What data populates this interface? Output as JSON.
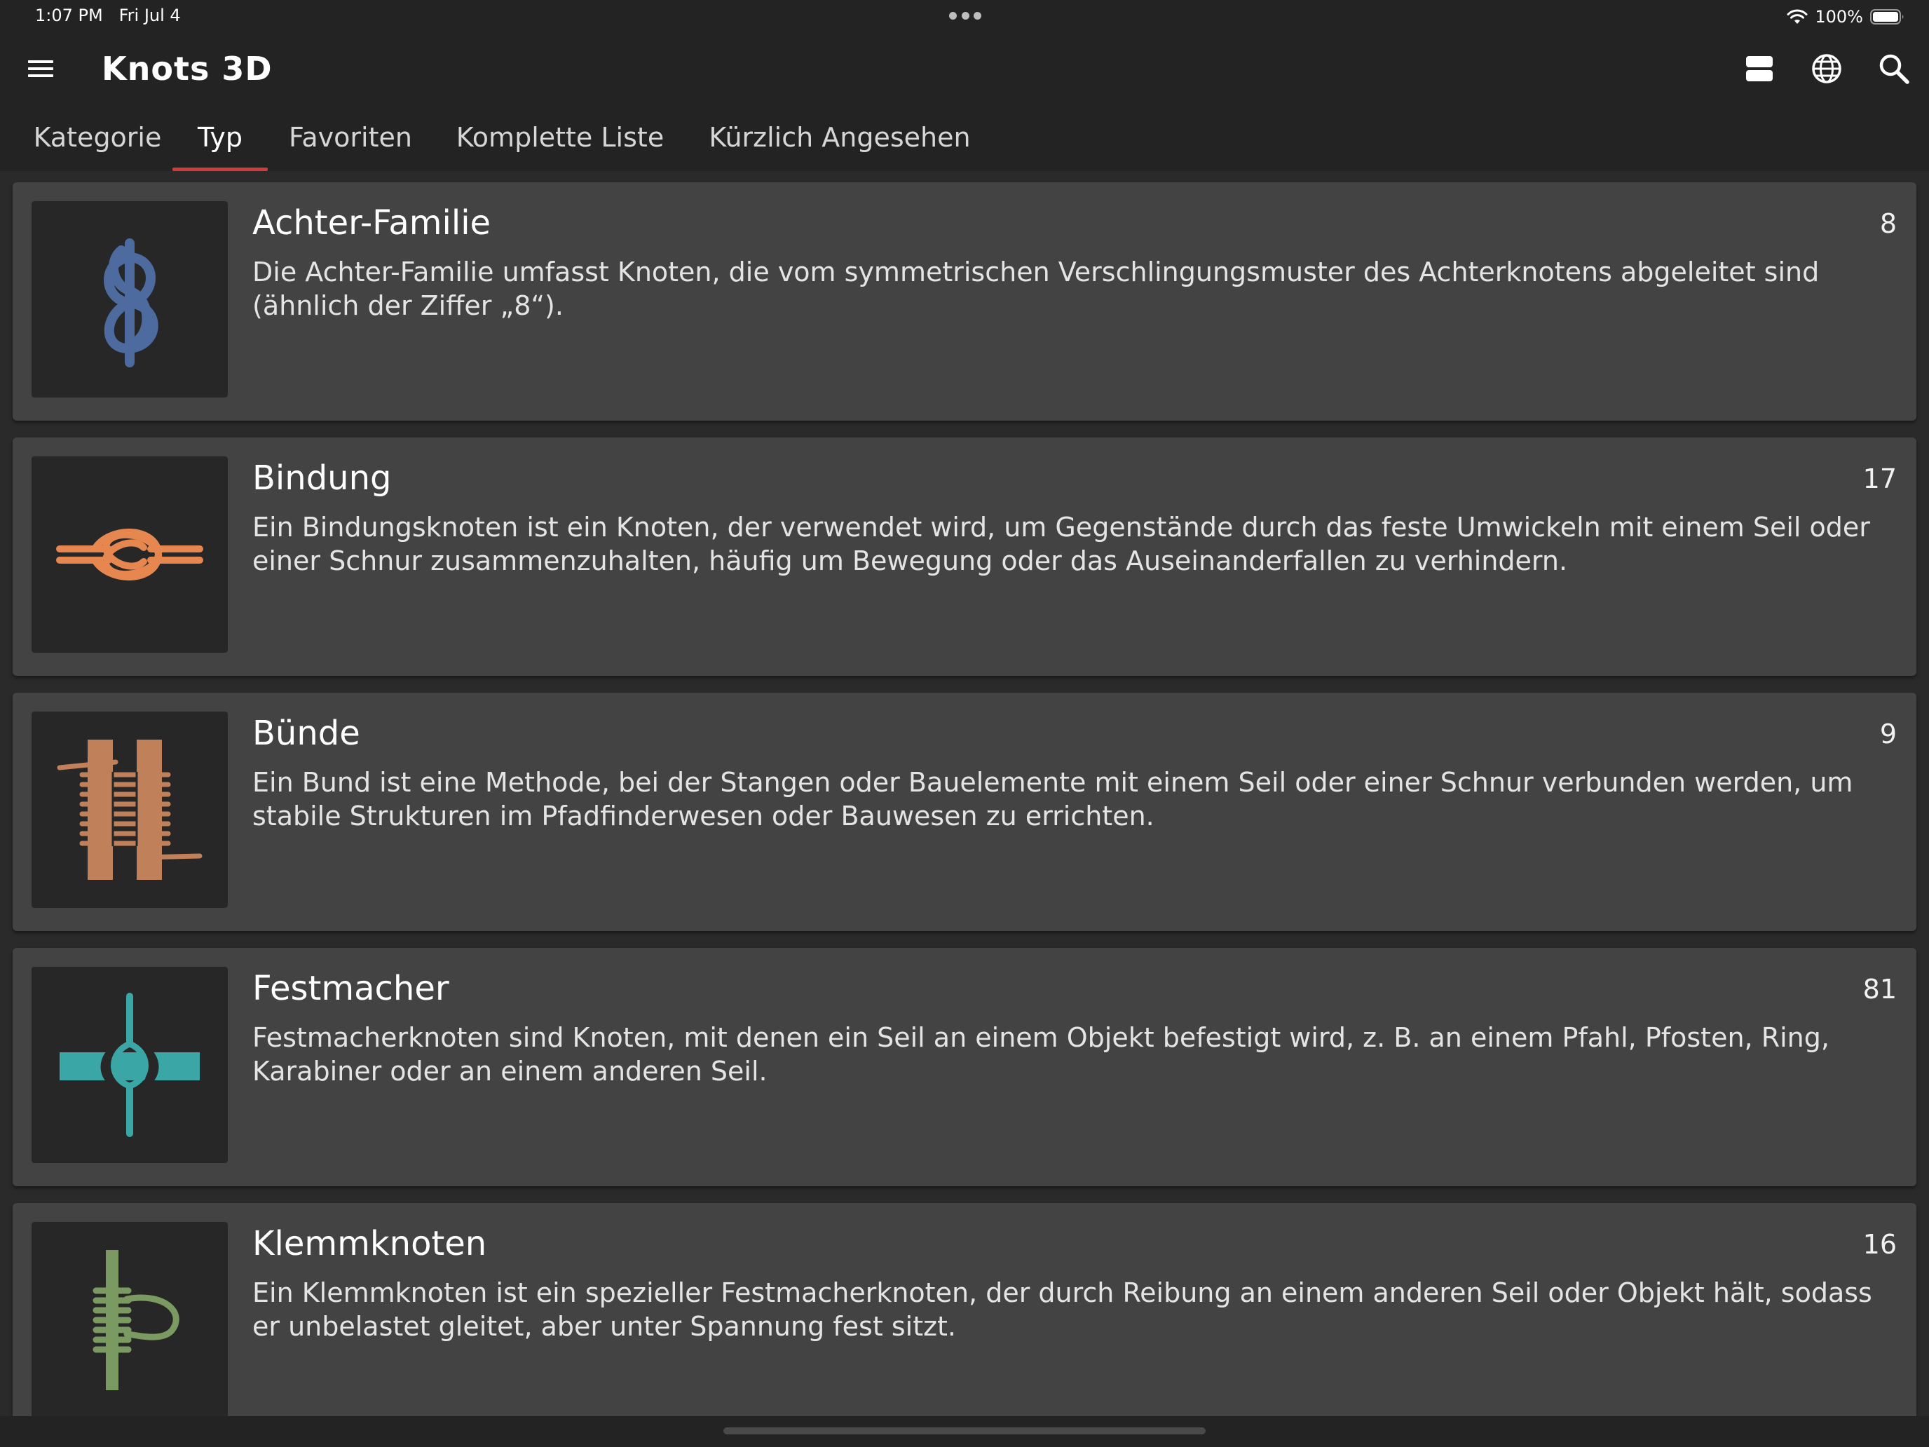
{
  "status_bar": {
    "time": "1:07 PM",
    "date": "Fri Jul 4",
    "battery": "100%",
    "icons": [
      "wifi-icon",
      "battery-icon"
    ]
  },
  "app_bar": {
    "title": "Knots 3D",
    "icons": [
      "menu-icon",
      "view-toggle-icon",
      "globe-icon",
      "search-icon"
    ]
  },
  "tabs": [
    {
      "label": "Kategorie",
      "active": false
    },
    {
      "label": "Typ",
      "active": true
    },
    {
      "label": "Favoriten",
      "active": false
    },
    {
      "label": "Komplette Liste",
      "active": false
    },
    {
      "label": "Kürzlich Angesehen",
      "active": false
    }
  ],
  "categories": [
    {
      "title": "Achter-Familie",
      "count": "8",
      "description": "Die Achter-Familie umfasst Knoten, die vom symmetrischen Verschlingungsmuster des Achterknotens abgeleitet sind (ähnlich der Ziffer „8“).",
      "icon": "figure-eight-knot-icon",
      "color": "#4d6b9e"
    },
    {
      "title": "Bindung",
      "count": "17",
      "description": "Ein Bindungsknoten ist ein Knoten, der verwendet wird, um Gegenstände durch das feste Umwickeln mit einem Seil oder einer Schnur zusammenzuhalten, häufig um Bewegung oder das Auseinanderfallen zu verhindern.",
      "icon": "binding-knot-icon",
      "color": "#e5874f"
    },
    {
      "title": "Bünde",
      "count": "9",
      "description": "Ein Bund ist eine Methode, bei der Stangen oder Bauelemente mit einem Seil oder einer Schnur verbunden werden, um stabile Strukturen im Pfadfinderwesen oder Bauwesen zu errichten.",
      "icon": "lashing-icon",
      "color": "#c0815a"
    },
    {
      "title": "Festmacher",
      "count": "81",
      "description": "Festmacherknoten sind Knoten, mit denen ein Seil an einem Objekt befestigt wird, z. B. an einem Pfahl, Pfosten, Ring, Karabiner oder an einem anderen Seil.",
      "icon": "hitch-knot-icon",
      "color": "#3aa6a6"
    },
    {
      "title": "Klemmknoten",
      "count": "16",
      "description": "Ein Klemmknoten ist ein spezieller Festmacherknoten, der durch Reibung an einem anderen Seil oder Objekt hält, sodass er unbelastet gleitet, aber unter Spannung fest sitzt.",
      "icon": "friction-hitch-icon",
      "color": "#7a9a62"
    }
  ]
}
